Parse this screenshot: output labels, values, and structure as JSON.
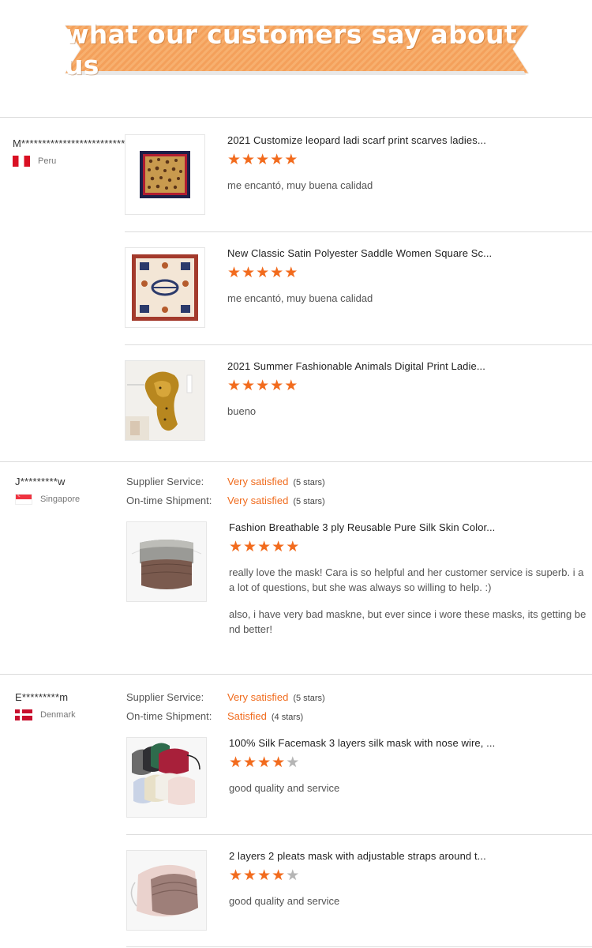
{
  "banner": {
    "title": "what our customers say about us",
    "color": "#f4a05b"
  },
  "labels": {
    "supplier_service": "Supplier Service:",
    "ontime_shipment": "On-time Shipment:"
  },
  "reviews": [
    {
      "reviewer": "M**************************o",
      "country": "Peru",
      "flag": "peru-flag",
      "items": [
        {
          "title": "2021 Customize leopard ladi scarf print scarves ladies...",
          "stars": 5,
          "comment": [
            "me encantó, muy buena calidad"
          ],
          "image": "leopard-scarf"
        },
        {
          "title": "New Classic Satin Polyester Saddle Women Square Sc...",
          "stars": 5,
          "comment": [
            "me encantó, muy buena calidad"
          ],
          "image": "saddle-scarf"
        },
        {
          "title": "2021 Summer Fashionable Animals Digital Print Ladie...",
          "stars": 5,
          "comment": [
            "bueno"
          ],
          "image": "animal-scarf"
        }
      ]
    },
    {
      "reviewer": "J*********w",
      "country": "Singapore",
      "flag": "singapore-flag",
      "supplier_service": {
        "value": "Very satisfied",
        "count": "(5 stars)"
      },
      "ontime_shipment": {
        "value": "Very satisfied",
        "count": "(5 stars)"
      },
      "items": [
        {
          "title": "Fashion Breathable 3 ply Reusable Pure Silk Skin Color...",
          "stars": 5,
          "comment": [
            "really love the mask! Cara is so helpful and her customer service is superb. i asked a lot of questions, but she was always so willing to help. :)",
            "also, i have very bad maskne, but ever since i wore these masks, its getting better and better!"
          ],
          "comment_lines": [
            "really love the mask! Cara is so helpful and her customer service is superb. i a",
            "a lot of questions, but she was always so willing to help. :)",
            "also, i have very bad maskne, but ever since i wore these masks, its getting be",
            "nd better!"
          ],
          "image": "silk-mask"
        }
      ]
    },
    {
      "reviewer": "E*********m",
      "country": "Denmark",
      "flag": "denmark-flag",
      "supplier_service": {
        "value": "Very satisfied",
        "count": "(5 stars)"
      },
      "ontime_shipment": {
        "value": "Satisfied",
        "count": "(4 stars)"
      },
      "items": [
        {
          "title": "100% Silk Facemask 3 layers silk mask with nose wire, ...",
          "stars": 4,
          "comment": [
            "good quality and service"
          ],
          "image": "multi-color-masks"
        },
        {
          "title": "2 layers 2 pleats mask with adjustable straps around t...",
          "stars": 4,
          "comment": [
            "good quality and service"
          ],
          "image": "pleated-mask"
        }
      ]
    }
  ],
  "colors": {
    "star": "#f26b1d",
    "star_empty": "#b5b5b5",
    "satisfaction": "#f06b1d"
  }
}
